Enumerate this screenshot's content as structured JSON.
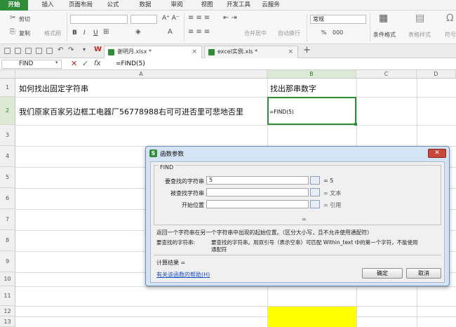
{
  "menu": {
    "tabs": [
      "开始",
      "插入",
      "页面布局",
      "公式",
      "数据",
      "审阅",
      "视图",
      "开发工具",
      "云服务"
    ],
    "active_index": 0
  },
  "ribbon": {
    "cut": "剪切",
    "copy": "复制",
    "format_painter": "格式刷",
    "bold": "B",
    "italic": "I",
    "underline": "U",
    "merge_center": "合并居中",
    "wrap_text": "自动换行",
    "number_format": "常规",
    "percent": "%",
    "thousands": "000",
    "conditional_format": "条件格式",
    "table_style": "表格样式",
    "symbol": "符号"
  },
  "doc_tabs": [
    {
      "name": "谢明月.xlsx *",
      "active": true
    },
    {
      "name": "excel实例.xls *",
      "active": false
    }
  ],
  "formula_bar": {
    "name_box": "FIND",
    "fx": "fx",
    "formula": "=FIND(5)"
  },
  "sheet": {
    "columns": [
      "A",
      "B",
      "C",
      "D"
    ],
    "selected_column": "B",
    "rows": [
      "1",
      "2",
      "3",
      "4",
      "5",
      "6",
      "7",
      "8",
      "9",
      "10",
      "11",
      "12",
      "13"
    ],
    "selected_row": "2",
    "cells": {
      "A1": "如何找出固定字符串",
      "B1": "找出那串数字",
      "A2": "我们原家百家另边框工电器厂56778988右可可进否里可悲地否里",
      "B2": "=FIND(5)"
    },
    "highlight_color": "#ffff00"
  },
  "dialog": {
    "title": "函数参数",
    "function_name": "FIND",
    "fields": [
      {
        "label": "要查找的字符串",
        "value": "5",
        "result": "= 5"
      },
      {
        "label": "被查找字符串",
        "value": "",
        "result": "= 文本"
      },
      {
        "label": "开始位置",
        "value": "",
        "result": "= 引用"
      }
    ],
    "equals_line": "=",
    "description": "返回一个字符串在另一个字符串中出现的起始位置。（区分大小写，且不允许使用通配符）",
    "param_label": "要查找的字符串:",
    "param_desc_line1": "要查找的字符串。用双引号（表示空串）可匹配 Within_text 中的第一个字符，不能使用",
    "param_desc_line2": "通配符",
    "calc_result": "计算结果 =",
    "help_link": "有关该函数的帮助(H)",
    "ok": "确定",
    "cancel": "取消"
  },
  "colors": {
    "accent": "#2f8d3a",
    "dialog_bg": "#d4e3f5",
    "close_button": "#c9483e"
  }
}
